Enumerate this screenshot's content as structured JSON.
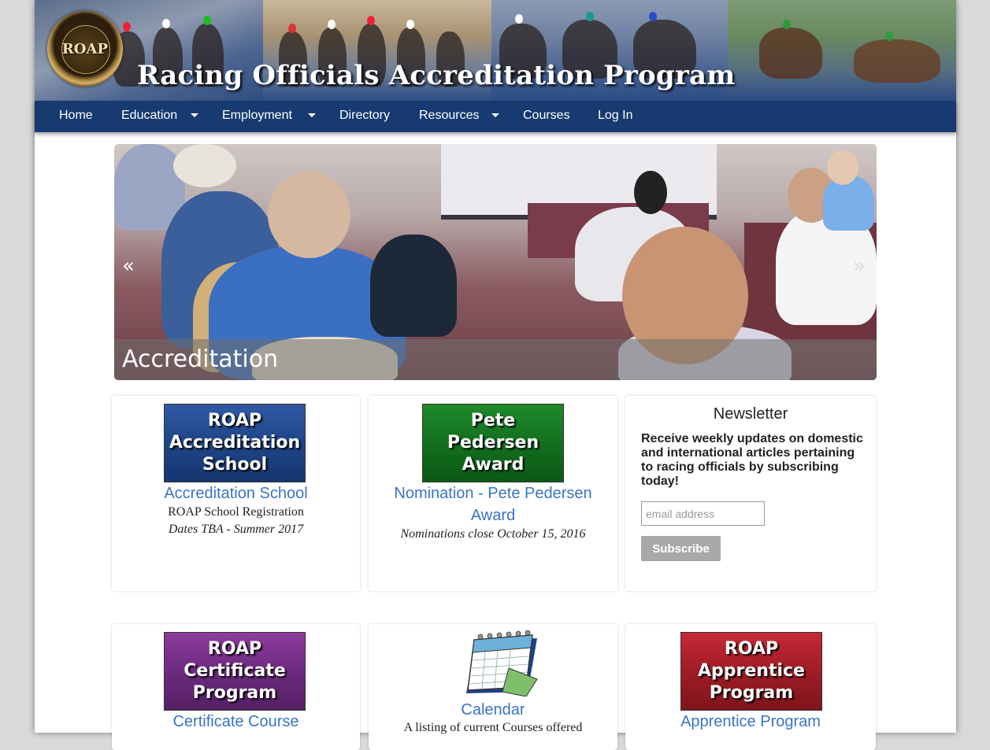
{
  "site": {
    "title": "Racing Officials Accreditation Program",
    "logo_text": "ROAP"
  },
  "nav": {
    "items": [
      {
        "label": "Home",
        "has_dropdown": false
      },
      {
        "label": "Education",
        "has_dropdown": true
      },
      {
        "label": "Employment",
        "has_dropdown": true
      },
      {
        "label": "Directory",
        "has_dropdown": false
      },
      {
        "label": "Resources",
        "has_dropdown": true
      },
      {
        "label": "Courses",
        "has_dropdown": false
      },
      {
        "label": "Log In",
        "has_dropdown": false
      }
    ]
  },
  "slider": {
    "caption": "Accreditation",
    "prev_label": "«",
    "next_label": "»"
  },
  "cards": {
    "accreditation": {
      "badge": "ROAP\nAccreditation\nSchool",
      "link": "Accreditation School",
      "line1": "ROAP School Registration",
      "line2": "Dates TBA - Summer 2017"
    },
    "pedersen": {
      "badge": "Pete\nPedersen\nAward",
      "link": "Nomination - Pete Pedersen Award",
      "line1": "Nominations close October 15, 2016"
    },
    "newsletter": {
      "title": "Newsletter",
      "description": "Receive weekly updates on domestic and international articles pertaining to racing officials by subscribing today!",
      "input_placeholder": "email address",
      "input_value": "",
      "button": "Subscribe"
    },
    "certificate": {
      "badge": "ROAP\nCertificate\nProgram",
      "link": "Certificate Course"
    },
    "calendar": {
      "link": "Calendar",
      "line1": "A listing of current Courses offered"
    },
    "apprentice": {
      "badge": "ROAP\nApprentice\nProgram",
      "link": "Apprentice Program"
    }
  },
  "colors": {
    "nav_bg": "#173a70",
    "link": "#3a73c4",
    "badge_blue": "#1f4587",
    "badge_green": "#137020",
    "badge_purple": "#6d2a80",
    "badge_red": "#a01c26",
    "subscribe_button": "#a9a9a9"
  }
}
